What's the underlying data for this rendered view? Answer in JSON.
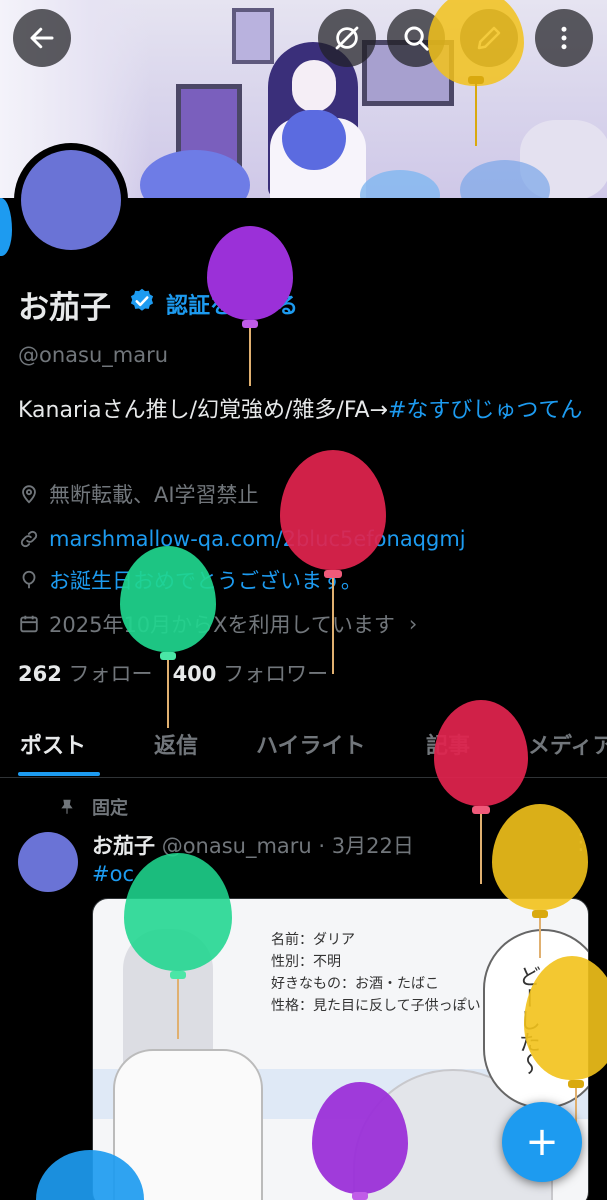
{
  "banner": {
    "back_icon": "arrow-left-icon",
    "grok_icon": "grok-icon",
    "search_icon": "search-icon",
    "edit_icon": "edit-pen-icon",
    "more_icon": "more-vertical-icon"
  },
  "profile": {
    "display_name": "お茄子",
    "get_verified": "認証を受ける",
    "handle": "@onasu_maru",
    "bio_text": "Kanariaさん推し/幻覚強め/雑多/FA→",
    "bio_hashtag": "#なすびじゅつてん",
    "location": "無断転載、AI学習禁止",
    "website": "marshmallow-qa.com/2bluc5efonaqgmj",
    "birthday": "お誕生日おめでとうございます。",
    "joined": "2025年10月からXを利用しています",
    "following_count": "262",
    "following_label": "フォロー",
    "followers_count": "400",
    "followers_label": "フォロワー"
  },
  "tabs": [
    "ポスト",
    "返信",
    "ハイライト",
    "記事",
    "メディア"
  ],
  "pinned_post": {
    "pinned_label": "固定",
    "author_name": "お茄子",
    "author_handle": "@onasu_maru",
    "separator": "·",
    "date": "3月22日",
    "hashtag": "#oc",
    "image_notes": "名前：ダリア\n性別：不明\n好きなもの：お酒・たばこ\n性格：見た目に反して子供っぽい",
    "image_speech": "どーした～"
  },
  "fab_label": "+",
  "colors": {
    "accent": "#1d9bf0",
    "text_primary": "#e7e9ea",
    "text_secondary": "#71767b",
    "background": "#000000",
    "balloon_purple": "#9b30d8",
    "balloon_red": "#e0234e",
    "balloon_green": "#1fd68e",
    "balloon_yellow": "#f2c21b",
    "balloon_blue": "#1d9bf0"
  }
}
